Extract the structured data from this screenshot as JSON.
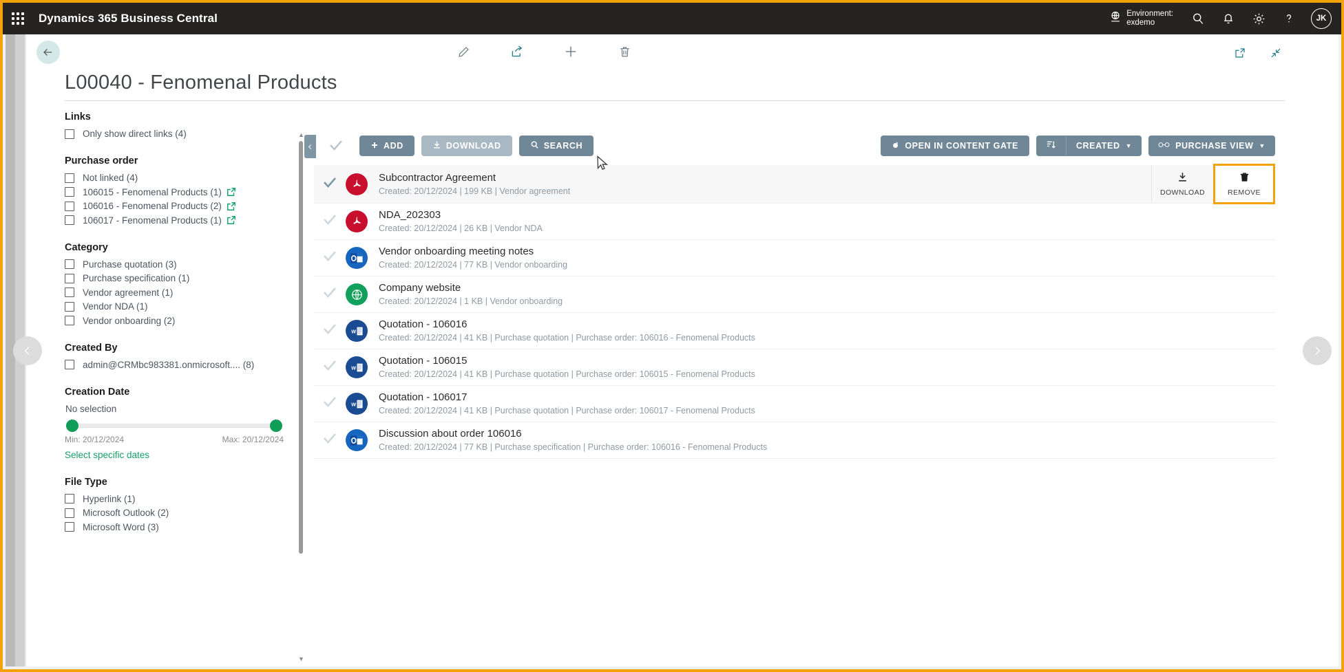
{
  "topbar": {
    "waffle_icon": "waffle-grid-icon",
    "app_title": "Dynamics 365 Business Central",
    "environment_label": "Environment:",
    "environment_name": "exdemo",
    "icons": [
      "globe-icon",
      "search-icon",
      "bell-icon",
      "gear-icon",
      "help-icon"
    ],
    "avatar_initials": "JK"
  },
  "page": {
    "back_icon": "back-arrow-icon",
    "title": "L00040 - Fenomenal Products",
    "command_icons": [
      "edit-pencil-icon",
      "share-icon",
      "add-plus-icon",
      "delete-trash-icon"
    ],
    "corner_icons": [
      "open-in-new-window-icon",
      "collapse-icon"
    ],
    "prev_page_icon": "chevron-left-icon",
    "next_page_icon": "chevron-right-icon"
  },
  "facets": {
    "groups": [
      {
        "title": "Links",
        "items": [
          {
            "label": "Only show direct links (4)",
            "checked": false,
            "external": false
          }
        ]
      },
      {
        "title": "Purchase order",
        "items": [
          {
            "label": "Not linked (4)",
            "checked": false,
            "external": false
          },
          {
            "label": "106015 - Fenomenal Products (1)",
            "checked": false,
            "external": true
          },
          {
            "label": "106016 - Fenomenal Products (2)",
            "checked": false,
            "external": true
          },
          {
            "label": "106017 - Fenomenal Products (1)",
            "checked": false,
            "external": true
          }
        ]
      },
      {
        "title": "Category",
        "items": [
          {
            "label": "Purchase quotation (3)",
            "checked": false,
            "external": false
          },
          {
            "label": "Purchase specification (1)",
            "checked": false,
            "external": false
          },
          {
            "label": "Vendor agreement (1)",
            "checked": false,
            "external": false
          },
          {
            "label": "Vendor NDA (1)",
            "checked": false,
            "external": false
          },
          {
            "label": "Vendor onboarding (2)",
            "checked": false,
            "external": false
          }
        ]
      },
      {
        "title": "Created By",
        "items": [
          {
            "label": "admin@CRMbc983381.onmicrosoft.... (8)",
            "checked": false,
            "external": false
          }
        ]
      }
    ],
    "creation_date": {
      "title": "Creation Date",
      "selection": "No selection",
      "min_label": "Min: 20/12/2024",
      "max_label": "Max: 20/12/2024",
      "select_specific": "Select specific dates",
      "handle_color": "#0f9d58"
    },
    "file_type": {
      "title": "File Type",
      "items": [
        {
          "label": "Hyperlink (1)",
          "checked": false
        },
        {
          "label": "Microsoft Outlook (2)",
          "checked": false
        },
        {
          "label": "Microsoft Word (3)",
          "checked": false
        }
      ]
    }
  },
  "toolbar": {
    "collapse_icon": "chevron-left-icon",
    "select_all_icon": "checkmark-icon",
    "add_label": "ADD",
    "download_label": "DOWNLOAD",
    "search_label": "SEARCH",
    "open_in_content_gate_label": "OPEN IN CONTENT GATE",
    "sort_icon": "sort-icon",
    "sort_label": "CREATED",
    "view_icon": "glasses-icon",
    "view_label": "PURCHASE VIEW"
  },
  "documents": [
    {
      "title": "Subcontractor Agreement",
      "meta": "Created: 20/12/2024 | 199 KB | Vendor agreement",
      "icon": "pdf-file-icon",
      "icon_kind": "pdf",
      "selected": true,
      "actions": [
        {
          "label": "DOWNLOAD",
          "icon": "download-icon",
          "highlighted": false
        },
        {
          "label": "REMOVE",
          "icon": "trash-icon",
          "highlighted": true
        }
      ]
    },
    {
      "title": "NDA_202303",
      "meta": "Created: 20/12/2024 | 26 KB | Vendor NDA",
      "icon": "pdf-file-icon",
      "icon_kind": "pdf",
      "selected": false,
      "actions": []
    },
    {
      "title": "Vendor onboarding meeting notes",
      "meta": "Created: 20/12/2024 | 77 KB | Vendor onboarding",
      "icon": "outlook-file-icon",
      "icon_kind": "outlook",
      "selected": false,
      "actions": []
    },
    {
      "title": "Company website",
      "meta": "Created: 20/12/2024 | 1 KB | Vendor onboarding",
      "icon": "globe-link-icon",
      "icon_kind": "web",
      "selected": false,
      "actions": []
    },
    {
      "title": "Quotation - 106016",
      "meta": "Created: 20/12/2024 | 41 KB | Purchase quotation | Purchase order: 106016 - Fenomenal Products",
      "icon": "word-file-icon",
      "icon_kind": "word",
      "selected": false,
      "actions": []
    },
    {
      "title": "Quotation - 106015",
      "meta": "Created: 20/12/2024 | 41 KB | Purchase quotation | Purchase order: 106015 - Fenomenal Products",
      "icon": "word-file-icon",
      "icon_kind": "word",
      "selected": false,
      "actions": []
    },
    {
      "title": "Quotation - 106017",
      "meta": "Created: 20/12/2024 | 41 KB | Purchase quotation | Purchase order: 106017 - Fenomenal Products",
      "icon": "word-file-icon",
      "icon_kind": "word",
      "selected": false,
      "actions": []
    },
    {
      "title": "Discussion about order 106016",
      "meta": "Created: 20/12/2024 | 77 KB | Purchase specification | Purchase order: 106016 - Fenomenal Products",
      "icon": "outlook-file-icon",
      "icon_kind": "outlook",
      "selected": false,
      "actions": []
    }
  ],
  "colors": {
    "topbar_bg": "#252423",
    "accent_highlight": "#f2a30a",
    "button_primary": "#6f8797",
    "button_muted": "#a9b8c2",
    "link_green": "#17a06a"
  }
}
